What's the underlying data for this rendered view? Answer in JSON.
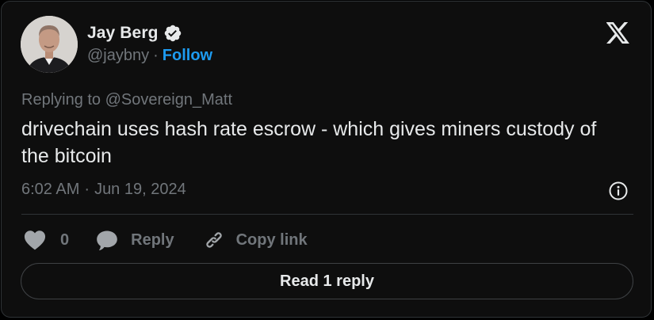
{
  "tweet": {
    "author": {
      "name": "Jay Berg",
      "handle": "@jaybny",
      "separator": "·",
      "follow_label": "Follow"
    },
    "reply_to": "Replying to @Sovereign_Matt",
    "text": "drivechain uses hash rate escrow - which gives miners custody of the bitcoin",
    "time": "6:02 AM",
    "meta_separator": "·",
    "date": "Jun 19, 2024"
  },
  "actions": {
    "like_count": "0",
    "reply_label": "Reply",
    "copy_label": "Copy link"
  },
  "read_button": {
    "label": "Read 1 reply"
  },
  "icons": {
    "brand": "x-logo-icon",
    "verified": "verified-badge-icon",
    "info": "info-icon",
    "like": "heart-icon",
    "reply": "speech-bubble-icon",
    "copy": "link-icon"
  },
  "colors": {
    "background": "#0e0e0e",
    "text_primary": "#e7e9ea",
    "text_secondary": "#71767b",
    "accent": "#1d9bf0",
    "border": "#2f3336"
  }
}
